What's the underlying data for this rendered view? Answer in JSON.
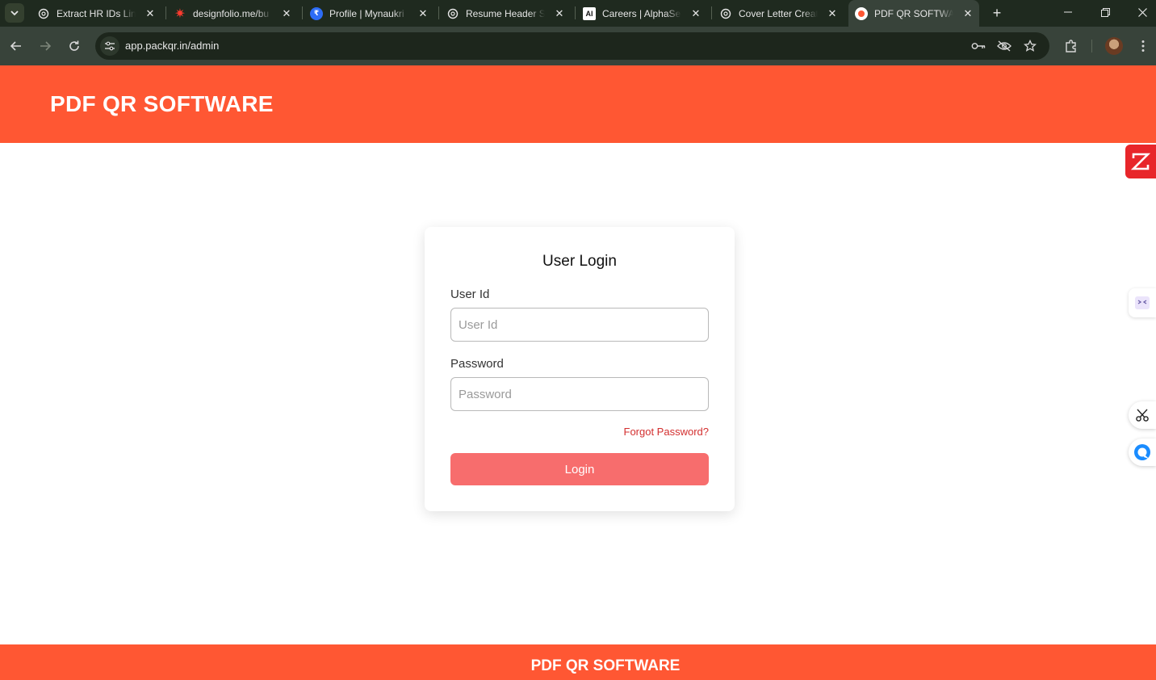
{
  "browser": {
    "tabs": [
      {
        "title": "Extract HR IDs Link",
        "icon": "openai-icon"
      },
      {
        "title": "designfolio.me/bu",
        "icon": "asterisk-icon"
      },
      {
        "title": "Profile | Mynaukri",
        "icon": "naukri-icon"
      },
      {
        "title": "Resume Header Su",
        "icon": "openai-icon"
      },
      {
        "title": "Careers | AlphaSen",
        "icon": "alphasense-icon",
        "icon_text": "AI"
      },
      {
        "title": "Cover Letter Creati",
        "icon": "openai-icon"
      },
      {
        "title": "PDF QR SOFTWAR",
        "icon": "pdfqr-icon",
        "active": true
      }
    ],
    "url": "app.packqr.in/admin"
  },
  "header": {
    "brand": "PDF QR SOFTWARE",
    "color": "#ff5733"
  },
  "login": {
    "title": "User Login",
    "userid_label": "User Id",
    "userid_placeholder": "User Id",
    "password_label": "Password",
    "password_placeholder": "Password",
    "forgot_label": "Forgot Password?",
    "login_label": "Login",
    "login_color": "#f76d6d",
    "forgot_color": "#d32f2f"
  },
  "footer": {
    "text": "PDF QR SOFTWARE"
  },
  "side_widgets": [
    "zoho-icon",
    "extension-icon",
    "scissors-icon",
    "chat-icon"
  ]
}
